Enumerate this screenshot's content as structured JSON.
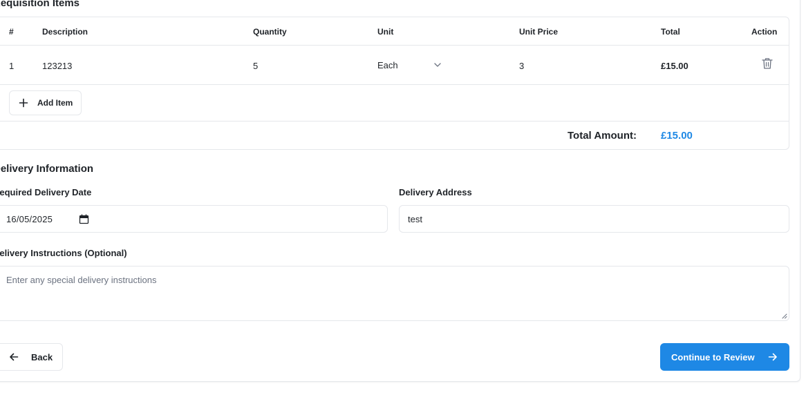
{
  "requisition": {
    "section_title": "Requisition Items",
    "columns": {
      "index": "#",
      "description": "Description",
      "quantity": "Quantity",
      "unit": "Unit",
      "unit_price": "Unit Price",
      "total": "Total",
      "action": "Action"
    },
    "rows": [
      {
        "index": "1",
        "description": "123213",
        "quantity": "5",
        "unit": "Each",
        "unit_price": "3",
        "total": "£15.00",
        "action_icon": "trash-icon"
      }
    ],
    "add_item_label": "Add Item",
    "total_amount_label": "Total Amount:",
    "total_amount_value": "£15.00"
  },
  "delivery": {
    "section_title": "Delivery Information",
    "date_label": "Required Delivery Date",
    "date_value": "16/05/2025",
    "address_label": "Delivery Address",
    "address_value": "test",
    "instructions_label": "Delivery Instructions (Optional)",
    "instructions_placeholder": "Enter any special delivery instructions"
  },
  "actions": {
    "back_label": "Back",
    "continue_label": "Continue to Review"
  },
  "colors": {
    "accent": "#1e88e5",
    "border": "#e5e7eb",
    "text": "#1f2328",
    "placeholder": "#6b7280"
  }
}
